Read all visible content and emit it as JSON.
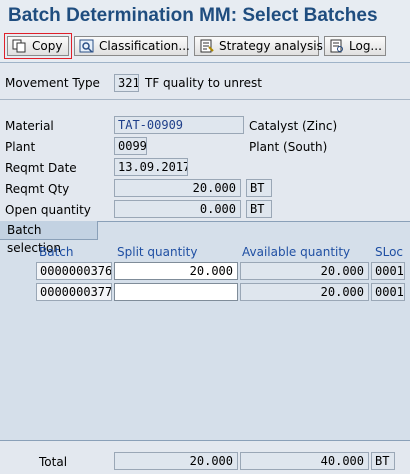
{
  "window": {
    "title": "Batch Determination MM: Select Batches"
  },
  "toolbar": {
    "copy": "Copy",
    "classification": "Classification...",
    "strategy": "Strategy analysis",
    "log": "Log..."
  },
  "movement": {
    "label": "Movement Type",
    "code": "321",
    "text": "TF quality to unrest"
  },
  "material": {
    "label": "Material",
    "value": "TAT-00909",
    "desc": "Catalyst (Zinc)"
  },
  "plant": {
    "label": "Plant",
    "value": "0099",
    "desc": "Plant (South)"
  },
  "reqmt_date": {
    "label": "Reqmt Date",
    "value": "13.09.2017"
  },
  "reqmt_qty": {
    "label": "Reqmt Qty",
    "value": "20.000",
    "unit": "BT"
  },
  "open_qty": {
    "label": "Open quantity",
    "value": "0.000",
    "unit": "BT"
  },
  "batch_selection": {
    "tab_label": "Batch selection",
    "columns": [
      "Batch",
      "Split quantity",
      "Available quantity",
      "SLoc"
    ],
    "rows": [
      {
        "batch": "0000000376",
        "split": "20.000",
        "available": "20.000",
        "sloc": "0001"
      },
      {
        "batch": "0000000377",
        "split": "",
        "available": "20.000",
        "sloc": "0001"
      }
    ]
  },
  "total": {
    "label": "Total",
    "split": "20.000",
    "available": "40.000",
    "unit": "BT"
  },
  "colors": {
    "title": "#1f4d7f",
    "header": "#1f4fa3",
    "selection": "#e0202a"
  }
}
